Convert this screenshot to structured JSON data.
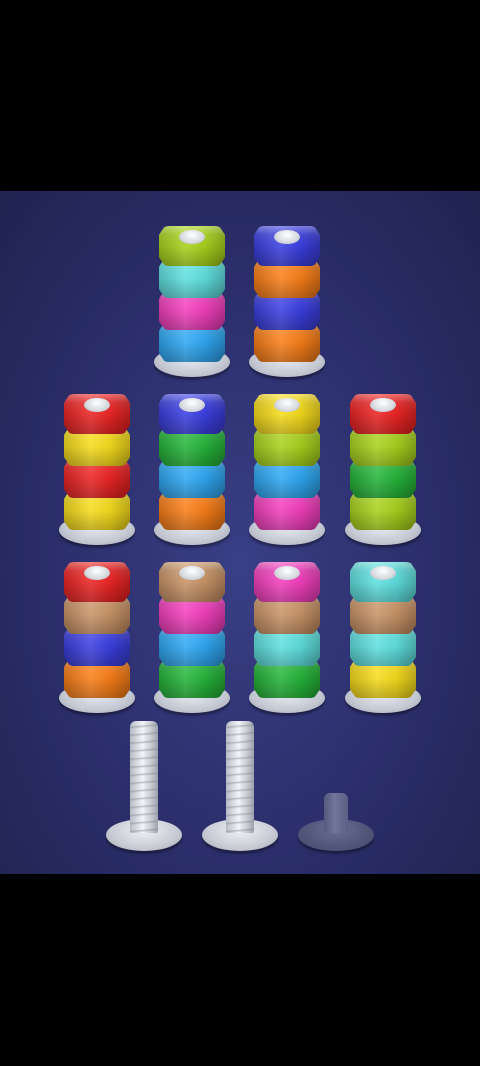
{
  "colors": {
    "lime": "#a8d21c",
    "cyan": "#5fe0df",
    "magenta": "#f23fbd",
    "sky": "#2fa8f3",
    "blue": "#3b3fe0",
    "orange": "#f97f19",
    "red": "#ec2424",
    "yellow": "#f6dc1c",
    "green": "#26b53a",
    "brown": "#c99467"
  },
  "pegs": [
    {
      "name": "peg-r1-c1",
      "stack": [
        "sky",
        "magenta",
        "cyan",
        "lime"
      ]
    },
    {
      "name": "peg-r1-c2",
      "stack": [
        "orange",
        "blue",
        "orange",
        "blue"
      ]
    },
    {
      "name": "peg-r2-c1",
      "stack": [
        "yellow",
        "red",
        "yellow",
        "red"
      ]
    },
    {
      "name": "peg-r2-c2",
      "stack": [
        "orange",
        "sky",
        "green",
        "blue"
      ]
    },
    {
      "name": "peg-r2-c3",
      "stack": [
        "magenta",
        "sky",
        "lime",
        "yellow"
      ]
    },
    {
      "name": "peg-r2-c4",
      "stack": [
        "lime",
        "green",
        "lime",
        "red"
      ]
    },
    {
      "name": "peg-r3-c1",
      "stack": [
        "orange",
        "blue",
        "brown",
        "red"
      ]
    },
    {
      "name": "peg-r3-c2",
      "stack": [
        "green",
        "sky",
        "magenta",
        "brown"
      ]
    },
    {
      "name": "peg-r3-c3",
      "stack": [
        "green",
        "cyan",
        "brown",
        "magenta"
      ]
    },
    {
      "name": "peg-r3-c4",
      "stack": [
        "yellow",
        "cyan",
        "brown",
        "cyan"
      ]
    }
  ],
  "bolts": [
    {
      "name": "empty-bolt-1",
      "state": "active"
    },
    {
      "name": "empty-bolt-2",
      "state": "active"
    },
    {
      "name": "locked-bolt-slot",
      "state": "locked"
    }
  ]
}
